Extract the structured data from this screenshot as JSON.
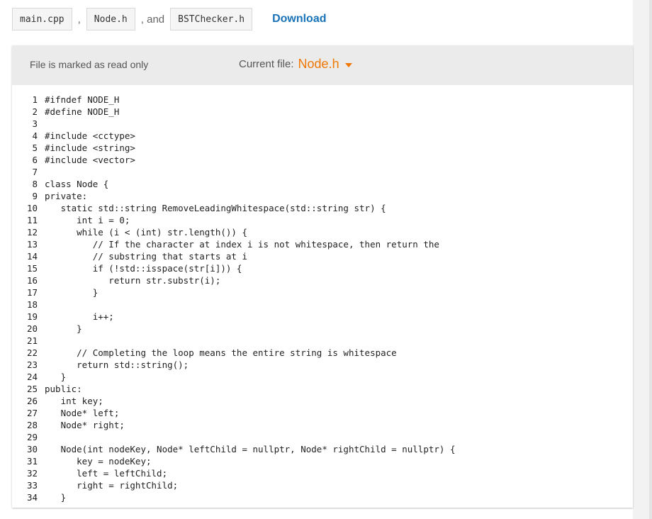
{
  "tabs": {
    "files": [
      "main.cpp",
      "Node.h",
      "BSTChecker.h"
    ],
    "sep_1": ",",
    "sep_2": ", and",
    "download": "Download"
  },
  "panel": {
    "readonly_text": "File is marked as read only",
    "current_file_label": "Current file:",
    "current_file_value": "Node.h"
  },
  "colors": {
    "accent_orange": "#f07800",
    "link_blue": "#1a73b8",
    "keyword_blue": "#1a1aa6",
    "comment_gray": "#555555"
  },
  "code": [
    {
      "n": "1",
      "text": "#ifndef NODE_H"
    },
    {
      "n": "2",
      "text": "#define NODE_H"
    },
    {
      "n": "3",
      "text": ""
    },
    {
      "n": "4",
      "text": "#include <cctype>"
    },
    {
      "n": "5",
      "text": "#include <string>"
    },
    {
      "n": "6",
      "text": "#include <vector>"
    },
    {
      "n": "7",
      "text": ""
    },
    {
      "n": "8",
      "text": "class Node {"
    },
    {
      "n": "9",
      "text": "private:"
    },
    {
      "n": "10",
      "text": "   static std::string RemoveLeadingWhitespace(std::string str) {"
    },
    {
      "n": "11",
      "text": "      int i = 0;"
    },
    {
      "n": "12",
      "text": "      while (i < (int) str.length()) {"
    },
    {
      "n": "13",
      "text": "         // If the character at index i is not whitespace, then return the"
    },
    {
      "n": "14",
      "text": "         // substring that starts at i"
    },
    {
      "n": "15",
      "text": "         if (!std::isspace(str[i])) {"
    },
    {
      "n": "16",
      "text": "            return str.substr(i);"
    },
    {
      "n": "17",
      "text": "         }"
    },
    {
      "n": "18",
      "text": ""
    },
    {
      "n": "19",
      "text": "         i++;"
    },
    {
      "n": "20",
      "text": "      }"
    },
    {
      "n": "21",
      "text": ""
    },
    {
      "n": "22",
      "text": "      // Completing the loop means the entire string is whitespace"
    },
    {
      "n": "23",
      "text": "      return std::string();"
    },
    {
      "n": "24",
      "text": "   }"
    },
    {
      "n": "25",
      "text": "public:"
    },
    {
      "n": "26",
      "text": "   int key;"
    },
    {
      "n": "27",
      "text": "   Node* left;"
    },
    {
      "n": "28",
      "text": "   Node* right;"
    },
    {
      "n": "29",
      "text": ""
    },
    {
      "n": "30",
      "text": "   Node(int nodeKey, Node* leftChild = nullptr, Node* rightChild = nullptr) {"
    },
    {
      "n": "31",
      "text": "      key = nodeKey;"
    },
    {
      "n": "32",
      "text": "      left = leftChild;"
    },
    {
      "n": "33",
      "text": "      right = rightChild;"
    },
    {
      "n": "34",
      "text": "   }"
    }
  ]
}
